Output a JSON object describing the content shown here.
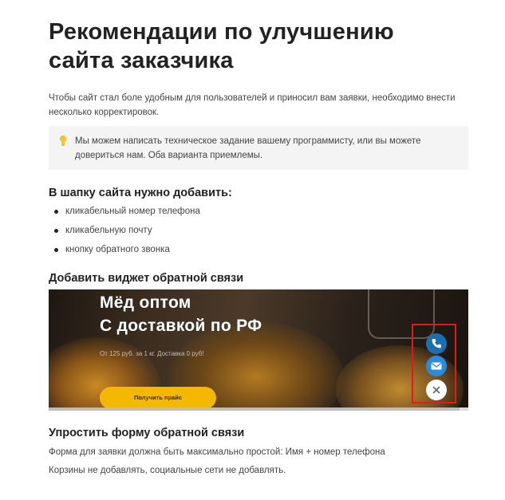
{
  "article": {
    "title": "Рекомендации по улучшению сайта заказчика",
    "intro": "Чтобы сайт стал боле удобным для пользователей и приносил вам заявки, необходимо внести несколько корректировок.",
    "callout": {
      "icon": "lightbulb-icon",
      "text": "Мы можем написать техническое задание вашему программисту, или вы можете довериться нам. Оба варианта приемлемы."
    },
    "section_header": {
      "heading": "В шапку сайта нужно добавить:",
      "items": [
        "кликабельный номер телефона",
        "кликабельную почту",
        "кнопку обратного звонка"
      ]
    },
    "section_widget": {
      "heading": "Добавить виджет обратной связи",
      "banner": {
        "title": "Мёд оптом\nС доставкой по РФ",
        "subtitle": "От 125 руб. за 1 кг. Доставка 0 руб!",
        "cta": "Получить прайс",
        "widget_icons": [
          "phone-icon",
          "mail-icon",
          "close-icon"
        ],
        "highlight_color": "#e01b1b"
      }
    },
    "section_form": {
      "heading": "Упростить форму обратной связи",
      "paragraph1": "Форма для заявки должна быть максимально простой: Имя + номер телефона",
      "paragraph2": "Корзины не добавлять, социальные сети не добавлять."
    }
  }
}
